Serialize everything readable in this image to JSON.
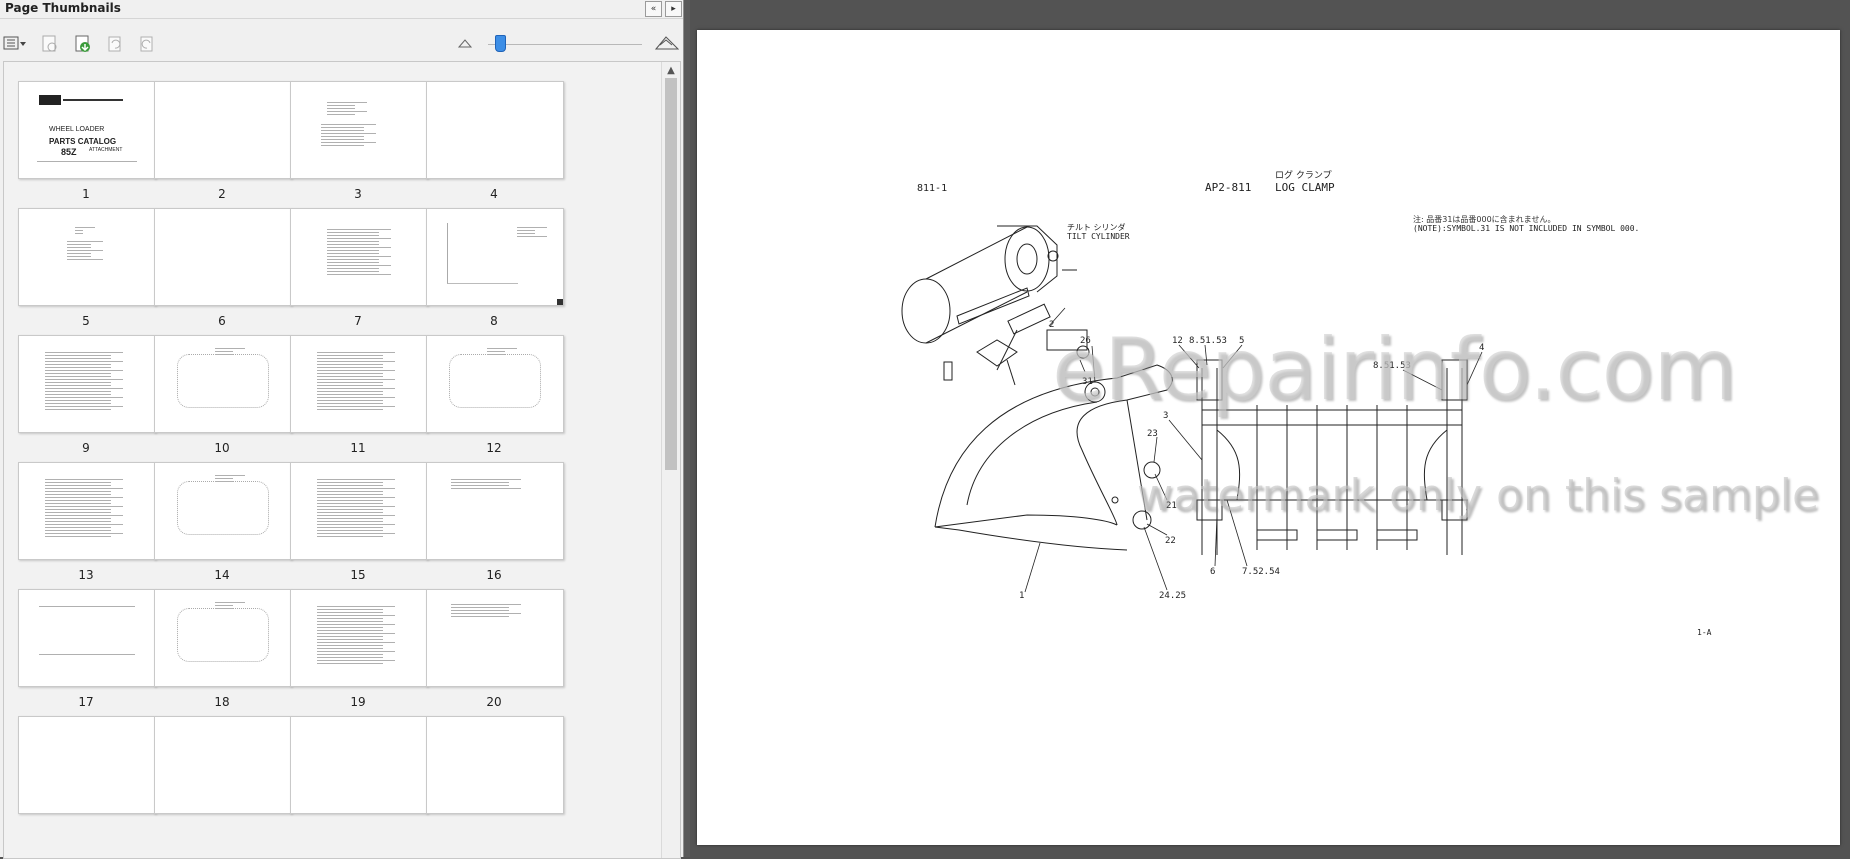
{
  "panel": {
    "title": "Page Thumbnails",
    "collapse_label": "«",
    "expand_label": "▸"
  },
  "toolbar": {
    "options_icon": "options-menu-icon",
    "delete_icon": "delete-pages-icon",
    "insert_icon": "insert-pages-icon",
    "rotate_left_icon": "rotate-icon",
    "rotate_right_icon": "rotate-icon",
    "zoom_out_icon": "small-mountain-icon",
    "zoom_in_icon": "large-mountain-icon",
    "zoom_level": 0.08
  },
  "thumbnails": [
    {
      "label": "1"
    },
    {
      "label": "2"
    },
    {
      "label": "3"
    },
    {
      "label": "4"
    },
    {
      "label": "5"
    },
    {
      "label": "6"
    },
    {
      "label": "7"
    },
    {
      "label": "8"
    },
    {
      "label": "9"
    },
    {
      "label": "10"
    },
    {
      "label": "11"
    },
    {
      "label": "12"
    },
    {
      "label": "13"
    },
    {
      "label": "14"
    },
    {
      "label": "15"
    },
    {
      "label": "16"
    },
    {
      "label": "17"
    },
    {
      "label": "18"
    },
    {
      "label": "19"
    },
    {
      "label": "20"
    }
  ],
  "thumb1_text": {
    "line1": "WHEEL LOADER",
    "line2": "PARTS CATALOG",
    "line3": "85Z",
    "line4": "ATTACHMENT"
  },
  "document": {
    "page_ref": "811-1",
    "section_code": "AP2-811",
    "section_kana": "ログ クランプ",
    "section_title": "LOG CLAMP",
    "note_kana": "注: 品番31は品番000に含まれません。",
    "note_text": "(NOTE):SYMBOL.31 IS NOT INCLUDED IN SYMBOL 000.",
    "cyl_kana": "チルト シリンダ",
    "cyl_label": "TILT CYLINDER",
    "callouts": [
      "2",
      "26",
      "31",
      "23",
      "3",
      "21",
      "22",
      "1",
      "24.25",
      "12",
      "8.51.53",
      "5",
      "8.51.53",
      "4",
      "6",
      "7.52.54"
    ],
    "footer": "1-A"
  },
  "watermark": {
    "site": "eRepairinfo.com",
    "note": "watermark only on this sample"
  }
}
